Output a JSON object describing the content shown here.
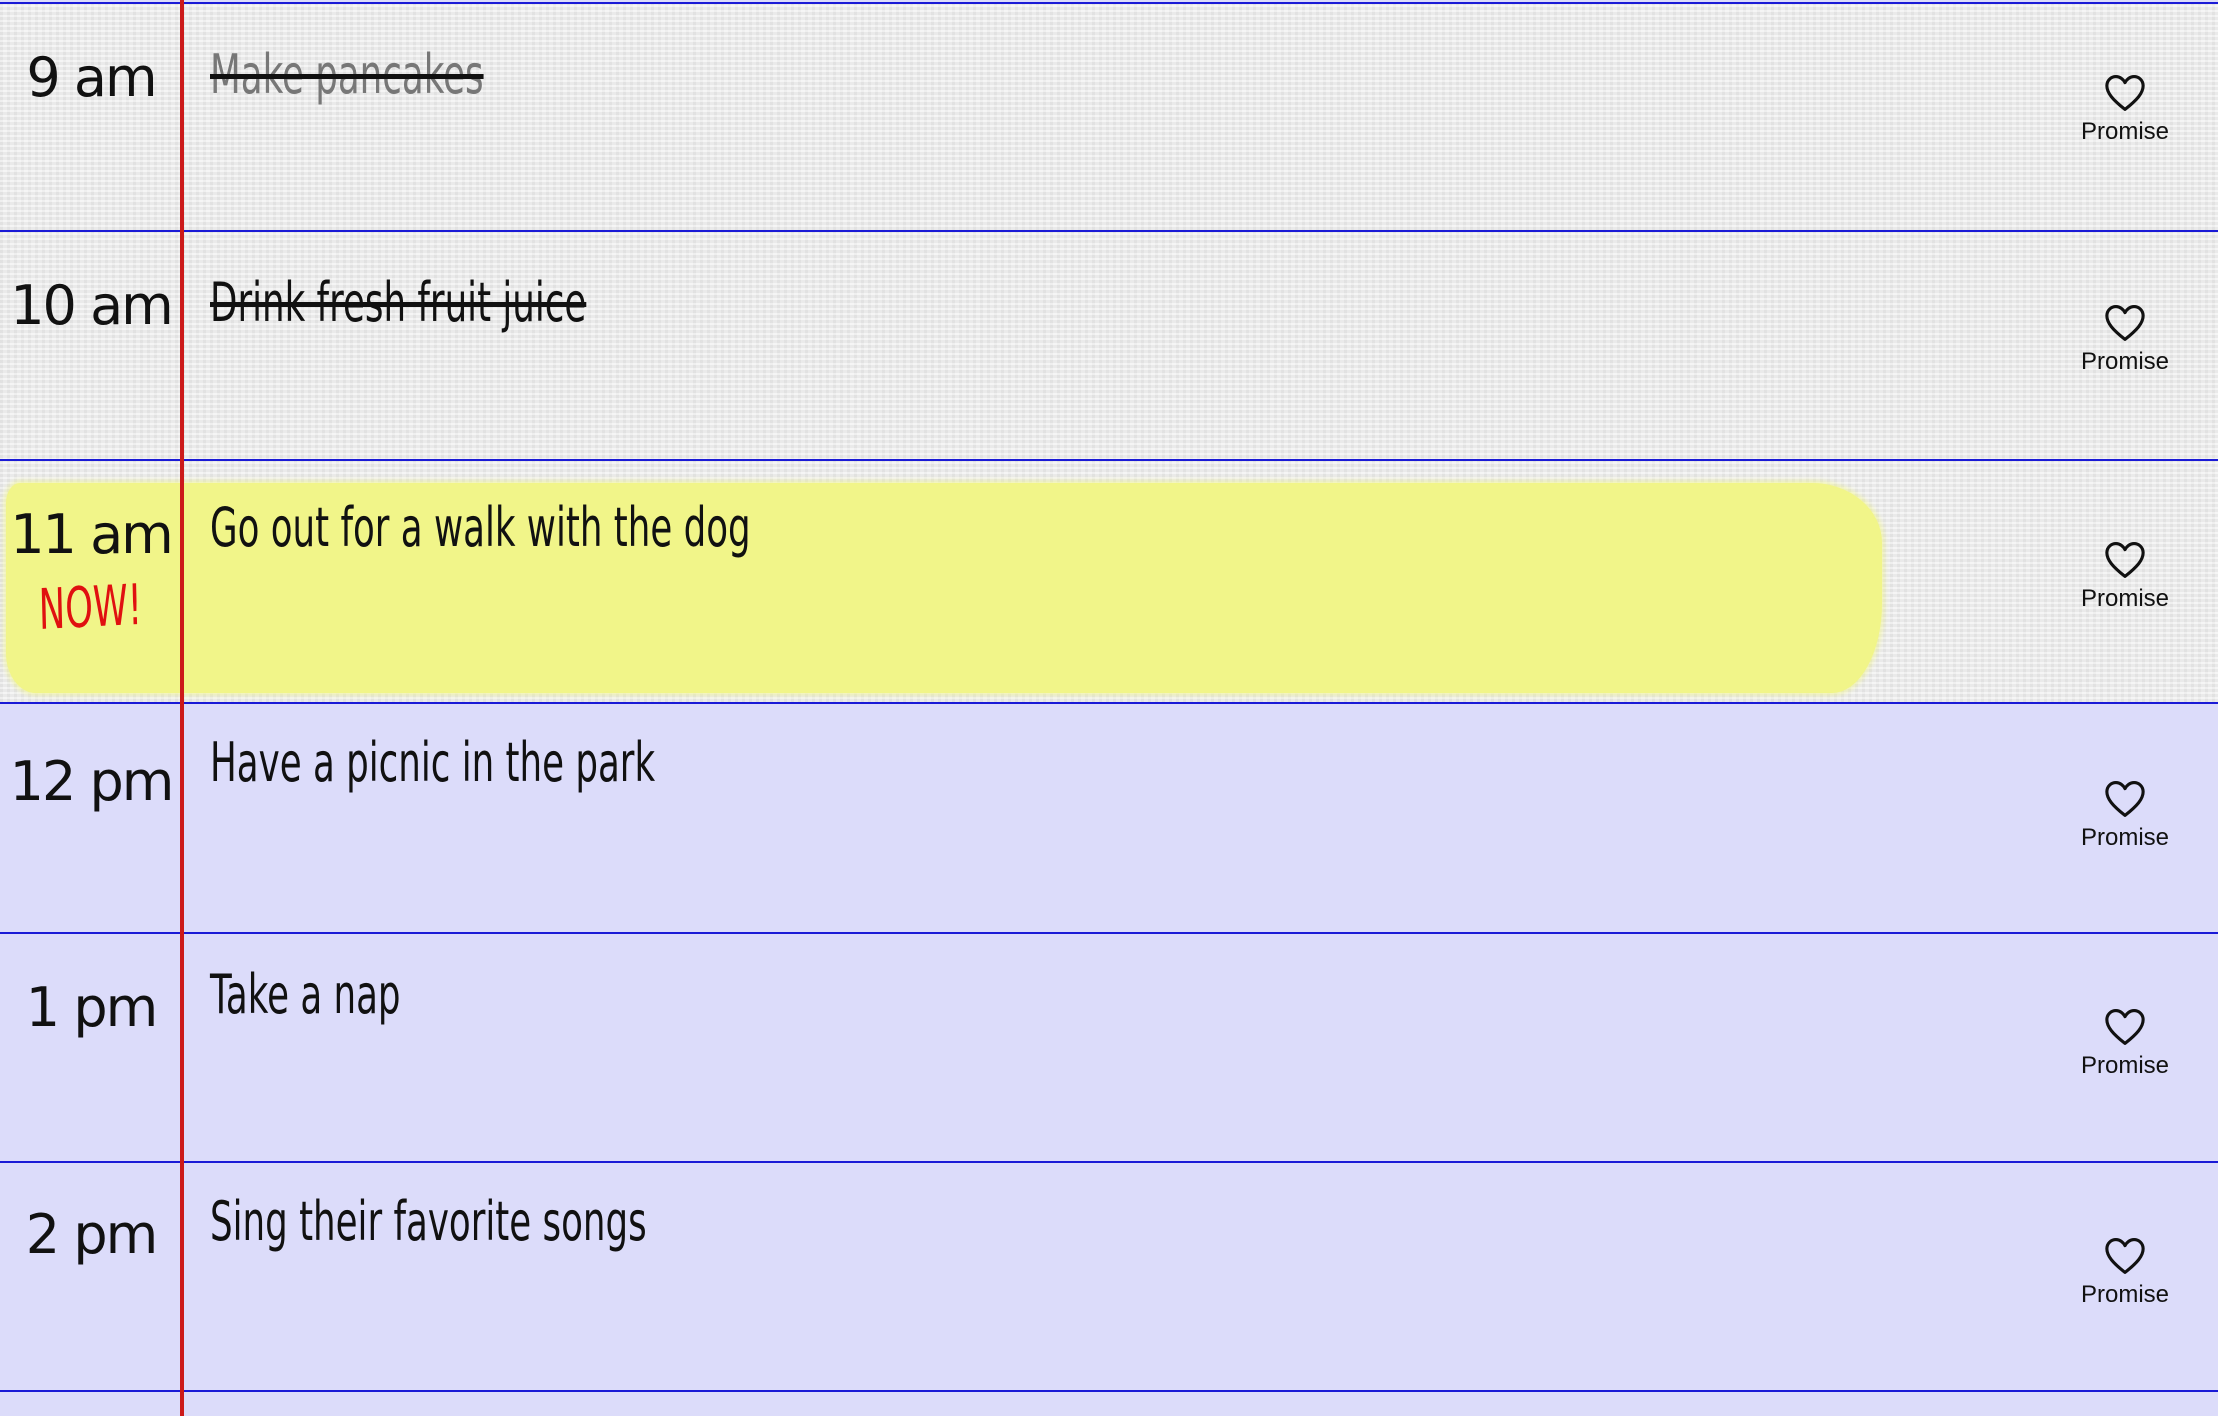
{
  "schedule": [
    {
      "time": "9 am",
      "task": "Make pancakes",
      "status": "done",
      "promise_label": "Promise",
      "icon": "heart-outline-icon"
    },
    {
      "time": "10 am",
      "task": "Drink fresh fruit juice",
      "status": "done",
      "promise_label": "Promise",
      "icon": "heart-outline-icon"
    },
    {
      "time": "11 am",
      "task": "Go out for a walk with the dog",
      "status": "current",
      "now_label": "NOW!",
      "promise_label": "Promise",
      "icon": "heart-outline-icon"
    },
    {
      "time": "12 pm",
      "task": "Have a picnic in the park",
      "status": "upcoming",
      "promise_label": "Promise",
      "icon": "heart-outline-icon"
    },
    {
      "time": "1 pm",
      "task": "Take a nap",
      "status": "upcoming",
      "promise_label": "Promise",
      "icon": "heart-outline-icon"
    },
    {
      "time": "2 pm",
      "task": "Sing their favorite songs",
      "status": "upcoming",
      "promise_label": "Promise",
      "icon": "heart-outline-icon"
    }
  ],
  "colors": {
    "rule_line": "#1a1ad6",
    "margin_line": "#cc1a1a",
    "highlight": "#f1f589",
    "now_label": "#e01010",
    "upcoming_background": "#dcdcfa",
    "past_background": "#ebebeb"
  }
}
